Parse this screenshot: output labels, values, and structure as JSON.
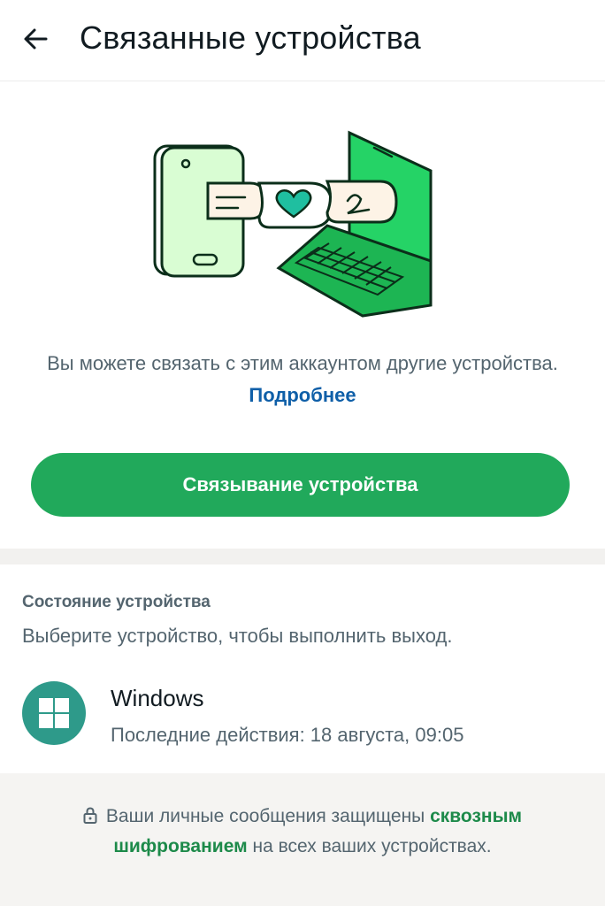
{
  "header": {
    "title": "Связанные устройства",
    "back_icon": "arrow-left-icon"
  },
  "hero": {
    "illustration_icon": "linked-devices-illustration",
    "description_text": "Вы можете связать с этим аккаунтом другие устройства.",
    "learn_more": "Подробнее",
    "link_button": "Связывание устройства"
  },
  "devices": {
    "section_title": "Состояние устройства",
    "section_subtitle": "Выберите устройство, чтобы выполнить выход.",
    "items": [
      {
        "name": "Windows",
        "status": "Последние действия: 18 августа, 09:05",
        "icon": "windows-logo-icon"
      }
    ]
  },
  "footer": {
    "text_before": "Ваши личные сообщения защищены",
    "highlight": "сквозным шифрованием",
    "text_after": "на всех ваших устройствах.",
    "lock_icon": "lock-icon"
  },
  "colors": {
    "accent": "#21a95b",
    "link": "#0f5fa8",
    "secondary_text": "#54656f",
    "device_avatar": "#2e9a8a",
    "footer_bg": "#f5f4f2"
  }
}
